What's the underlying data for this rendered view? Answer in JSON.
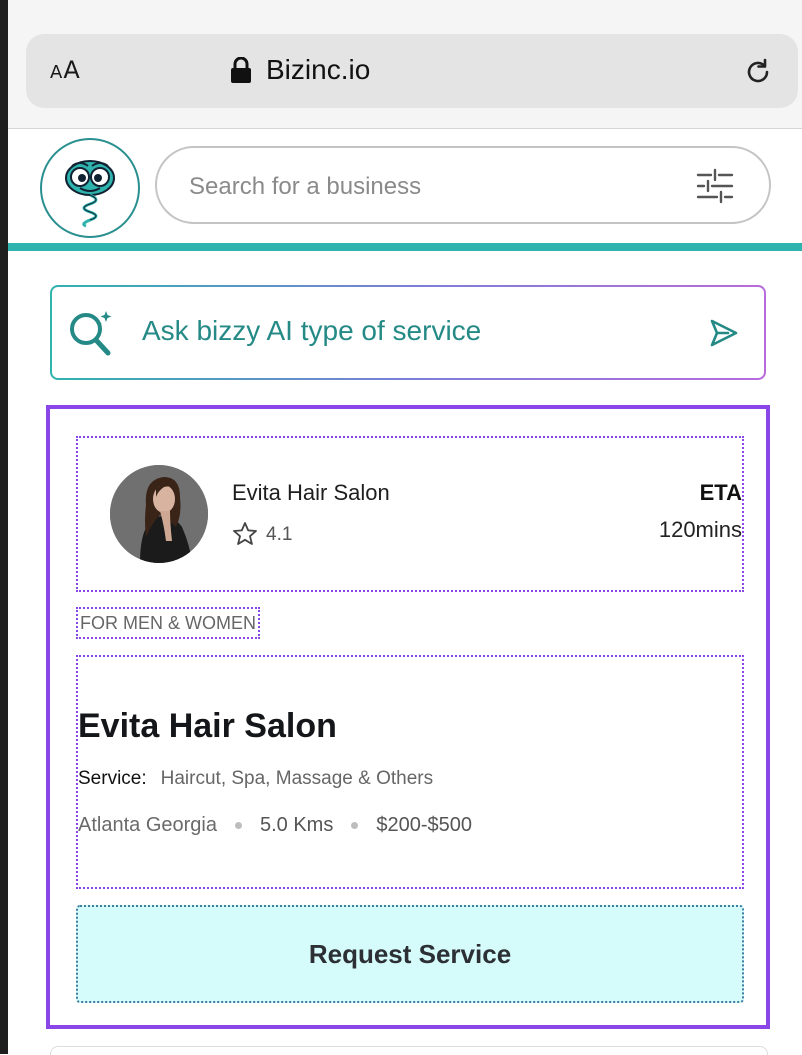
{
  "browser": {
    "text_size_label_small": "A",
    "text_size_label_large": "A",
    "url": "Bizinc.io"
  },
  "header": {
    "search_placeholder": "Search for a business"
  },
  "ai_prompt": {
    "text": "Ask bizzy AI type of service"
  },
  "listing": {
    "name": "Evita Hair Salon",
    "rating": "4.1",
    "eta_label": "ETA",
    "eta_value": "120mins",
    "tag": "FOR MEN & WOMEN",
    "title": "Evita Hair Salon",
    "service_label": "Service:",
    "services": "Haircut, Spa, Massage & Others",
    "location": "Atlanta Georgia",
    "distance": "5.0 Kms",
    "price_range": "$200-$500",
    "request_button": "Request Service"
  },
  "colors": {
    "accent_teal": "#2fb3ad",
    "card_border": "#8b46e8",
    "button_bg": "#d6fbfb",
    "ai_text": "#258a86"
  }
}
